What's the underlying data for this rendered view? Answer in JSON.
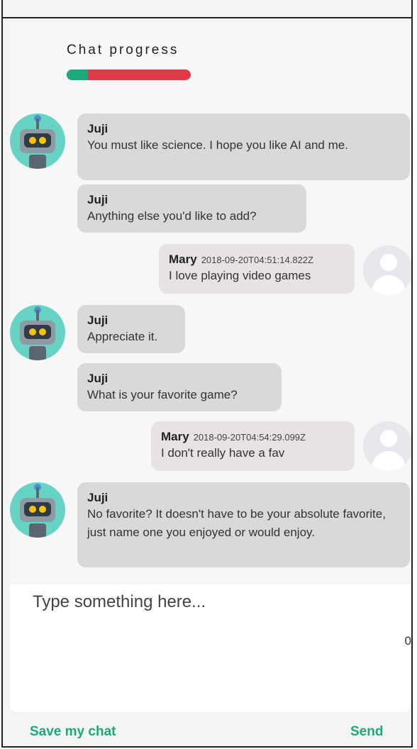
{
  "progress": {
    "title": "Chat progress",
    "fraction": 0.17,
    "done_color": "#1aa87c",
    "remaining_color": "#e03a48"
  },
  "messages": [
    {
      "sender": "Juji",
      "text": "You must like science. I hope you like AI and me."
    },
    {
      "sender": "Juji",
      "text": "Anything else you'd like to add?"
    },
    {
      "sender": "Mary",
      "timestamp": "2018-09-20T04:51:14.822Z",
      "text": "I love playing video games"
    },
    {
      "sender": "Juji",
      "text": "Appreciate it."
    },
    {
      "sender": "Juji",
      "text": "What is your favorite game?"
    },
    {
      "sender": "Mary",
      "timestamp": "2018-09-20T04:54:29.099Z",
      "text": "I don't really have a fav"
    },
    {
      "sender": "Juji",
      "text": "No favorite? It doesn't have to be your absolute favorite, just name one you enjoyed or would enjoy."
    }
  ],
  "composer": {
    "placeholder": "Type something here...",
    "char_count": "0"
  },
  "footer": {
    "save_label": "Save my chat",
    "send_label": "Send"
  }
}
